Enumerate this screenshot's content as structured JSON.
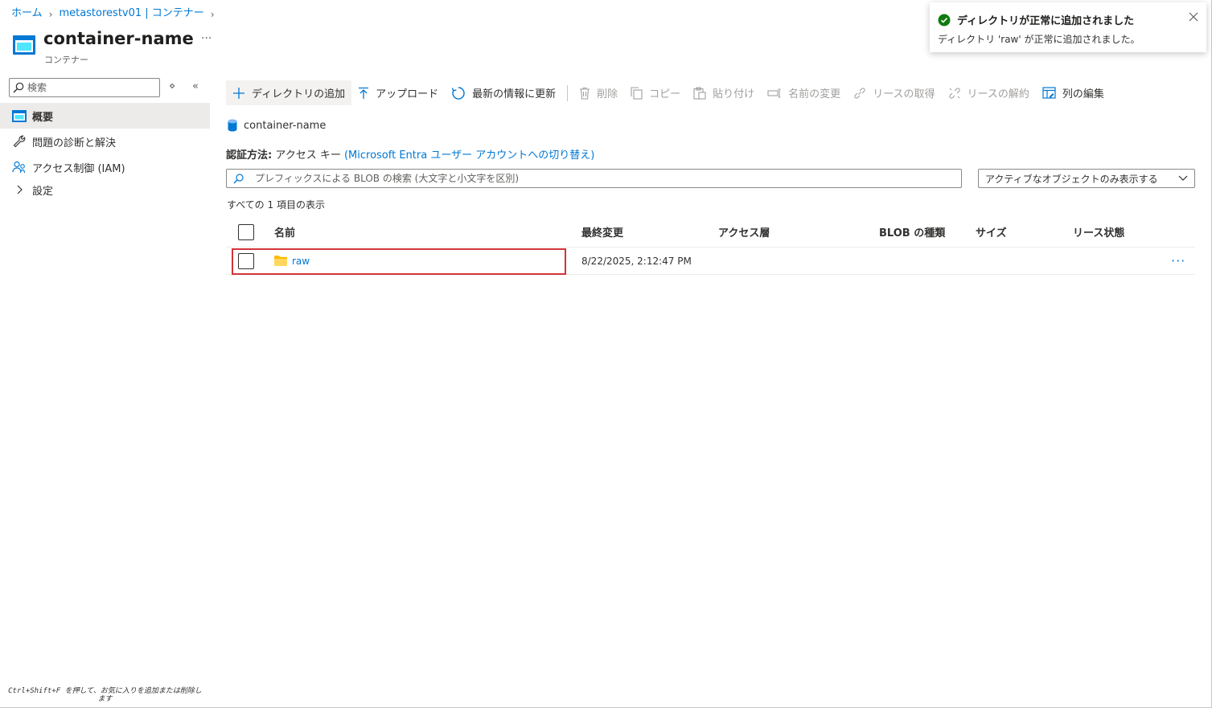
{
  "breadcrumb": {
    "home": "ホーム",
    "account": "metastorestv01 | コンテナー"
  },
  "header": {
    "title": "container-name",
    "subtitle": "コンテナー",
    "more": "···"
  },
  "sidebar": {
    "search_placeholder": "検索",
    "items": [
      {
        "label": "概要",
        "icon": "container-icon",
        "active": true
      },
      {
        "label": "問題の診断と解決",
        "icon": "wrench-icon"
      },
      {
        "label": "アクセス制御 (IAM)",
        "icon": "people-icon"
      },
      {
        "label": "設定",
        "icon": "chevron-right-icon"
      }
    ],
    "footer_hint": "Ctrl+Shift+F を押して、お気に入りを追加または削除します"
  },
  "toolbar": {
    "add_directory": "ディレクトリの追加",
    "upload": "アップロード",
    "refresh": "最新の情報に更新",
    "delete": "削除",
    "copy": "コピー",
    "paste": "貼り付け",
    "rename": "名前の変更",
    "acquire_lease": "リースの取得",
    "break_lease": "リースの解約",
    "edit_columns": "列の編集"
  },
  "path": {
    "container": "container-name"
  },
  "auth": {
    "label": "認証方法:",
    "value": "アクセス キー",
    "switch_link": "(Microsoft Entra ユーザー アカウントへの切り替え)"
  },
  "blob_search": {
    "placeholder": "プレフィックスによる BLOB の検索 (大文字と小文字を区別)"
  },
  "filter": {
    "selected": "アクティブなオブジェクトのみ表示する"
  },
  "count_text": "すべての 1 項目の表示",
  "table": {
    "columns": [
      "名前",
      "最終変更",
      "アクセス層",
      "BLOB の種類",
      "サイズ",
      "リース状態"
    ],
    "rows": [
      {
        "name": "raw",
        "modified": "8/22/2025, 2:12:47 PM",
        "tier": "",
        "blob_type": "",
        "size": "",
        "lease": ""
      }
    ]
  },
  "toast": {
    "title": "ディレクトリが正常に追加されました",
    "body": "ディレクトリ 'raw' が正常に追加されました。"
  },
  "colors": {
    "accent": "#0078d4",
    "highlight": "#d13438",
    "success": "#107c10",
    "folder": "#ffb900"
  }
}
